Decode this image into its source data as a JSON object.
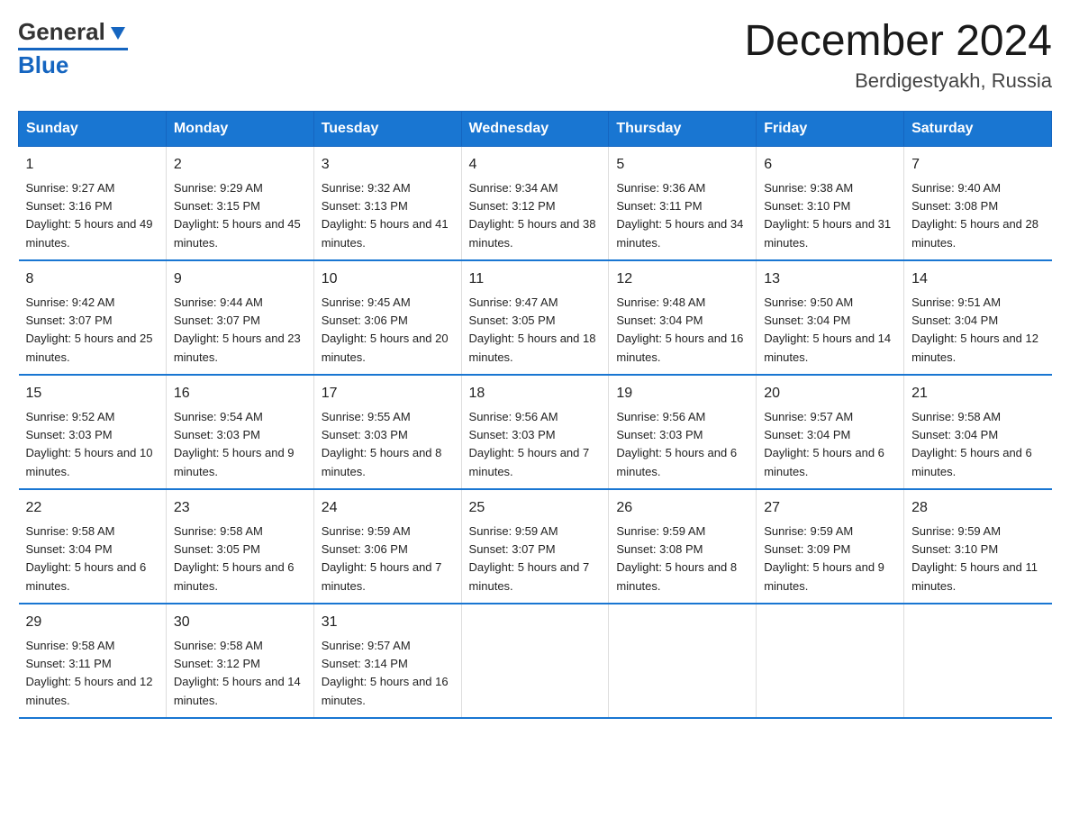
{
  "header": {
    "logo_general": "General",
    "logo_blue": "Blue",
    "title": "December 2024",
    "subtitle": "Berdigestyakh, Russia"
  },
  "days_of_week": [
    "Sunday",
    "Monday",
    "Tuesday",
    "Wednesday",
    "Thursday",
    "Friday",
    "Saturday"
  ],
  "weeks": [
    [
      {
        "day": "1",
        "sunrise": "9:27 AM",
        "sunset": "3:16 PM",
        "daylight": "5 hours and 49 minutes."
      },
      {
        "day": "2",
        "sunrise": "9:29 AM",
        "sunset": "3:15 PM",
        "daylight": "5 hours and 45 minutes."
      },
      {
        "day": "3",
        "sunrise": "9:32 AM",
        "sunset": "3:13 PM",
        "daylight": "5 hours and 41 minutes."
      },
      {
        "day": "4",
        "sunrise": "9:34 AM",
        "sunset": "3:12 PM",
        "daylight": "5 hours and 38 minutes."
      },
      {
        "day": "5",
        "sunrise": "9:36 AM",
        "sunset": "3:11 PM",
        "daylight": "5 hours and 34 minutes."
      },
      {
        "day": "6",
        "sunrise": "9:38 AM",
        "sunset": "3:10 PM",
        "daylight": "5 hours and 31 minutes."
      },
      {
        "day": "7",
        "sunrise": "9:40 AM",
        "sunset": "3:08 PM",
        "daylight": "5 hours and 28 minutes."
      }
    ],
    [
      {
        "day": "8",
        "sunrise": "9:42 AM",
        "sunset": "3:07 PM",
        "daylight": "5 hours and 25 minutes."
      },
      {
        "day": "9",
        "sunrise": "9:44 AM",
        "sunset": "3:07 PM",
        "daylight": "5 hours and 23 minutes."
      },
      {
        "day": "10",
        "sunrise": "9:45 AM",
        "sunset": "3:06 PM",
        "daylight": "5 hours and 20 minutes."
      },
      {
        "day": "11",
        "sunrise": "9:47 AM",
        "sunset": "3:05 PM",
        "daylight": "5 hours and 18 minutes."
      },
      {
        "day": "12",
        "sunrise": "9:48 AM",
        "sunset": "3:04 PM",
        "daylight": "5 hours and 16 minutes."
      },
      {
        "day": "13",
        "sunrise": "9:50 AM",
        "sunset": "3:04 PM",
        "daylight": "5 hours and 14 minutes."
      },
      {
        "day": "14",
        "sunrise": "9:51 AM",
        "sunset": "3:04 PM",
        "daylight": "5 hours and 12 minutes."
      }
    ],
    [
      {
        "day": "15",
        "sunrise": "9:52 AM",
        "sunset": "3:03 PM",
        "daylight": "5 hours and 10 minutes."
      },
      {
        "day": "16",
        "sunrise": "9:54 AM",
        "sunset": "3:03 PM",
        "daylight": "5 hours and 9 minutes."
      },
      {
        "day": "17",
        "sunrise": "9:55 AM",
        "sunset": "3:03 PM",
        "daylight": "5 hours and 8 minutes."
      },
      {
        "day": "18",
        "sunrise": "9:56 AM",
        "sunset": "3:03 PM",
        "daylight": "5 hours and 7 minutes."
      },
      {
        "day": "19",
        "sunrise": "9:56 AM",
        "sunset": "3:03 PM",
        "daylight": "5 hours and 6 minutes."
      },
      {
        "day": "20",
        "sunrise": "9:57 AM",
        "sunset": "3:04 PM",
        "daylight": "5 hours and 6 minutes."
      },
      {
        "day": "21",
        "sunrise": "9:58 AM",
        "sunset": "3:04 PM",
        "daylight": "5 hours and 6 minutes."
      }
    ],
    [
      {
        "day": "22",
        "sunrise": "9:58 AM",
        "sunset": "3:04 PM",
        "daylight": "5 hours and 6 minutes."
      },
      {
        "day": "23",
        "sunrise": "9:58 AM",
        "sunset": "3:05 PM",
        "daylight": "5 hours and 6 minutes."
      },
      {
        "day": "24",
        "sunrise": "9:59 AM",
        "sunset": "3:06 PM",
        "daylight": "5 hours and 7 minutes."
      },
      {
        "day": "25",
        "sunrise": "9:59 AM",
        "sunset": "3:07 PM",
        "daylight": "5 hours and 7 minutes."
      },
      {
        "day": "26",
        "sunrise": "9:59 AM",
        "sunset": "3:08 PM",
        "daylight": "5 hours and 8 minutes."
      },
      {
        "day": "27",
        "sunrise": "9:59 AM",
        "sunset": "3:09 PM",
        "daylight": "5 hours and 9 minutes."
      },
      {
        "day": "28",
        "sunrise": "9:59 AM",
        "sunset": "3:10 PM",
        "daylight": "5 hours and 11 minutes."
      }
    ],
    [
      {
        "day": "29",
        "sunrise": "9:58 AM",
        "sunset": "3:11 PM",
        "daylight": "5 hours and 12 minutes."
      },
      {
        "day": "30",
        "sunrise": "9:58 AM",
        "sunset": "3:12 PM",
        "daylight": "5 hours and 14 minutes."
      },
      {
        "day": "31",
        "sunrise": "9:57 AM",
        "sunset": "3:14 PM",
        "daylight": "5 hours and 16 minutes."
      },
      null,
      null,
      null,
      null
    ]
  ]
}
